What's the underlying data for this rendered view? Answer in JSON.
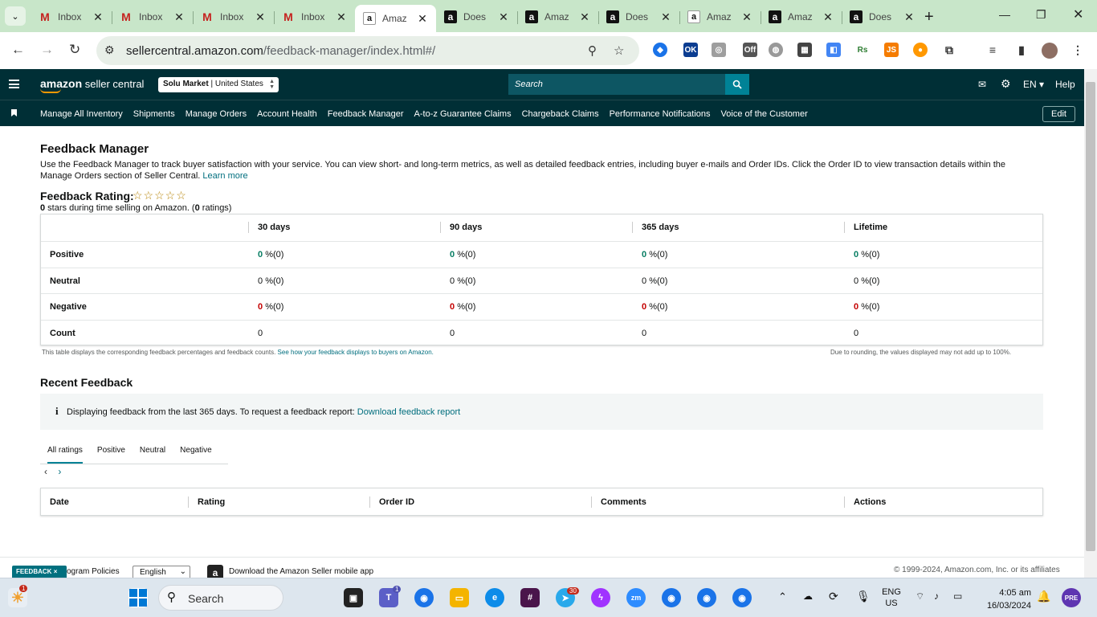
{
  "browser": {
    "tabs": [
      {
        "title": "Inbox",
        "favicon": "gmail-icon"
      },
      {
        "title": "Inbox",
        "favicon": "gmail-icon"
      },
      {
        "title": "Inbox",
        "favicon": "gmail-icon"
      },
      {
        "title": "Inbox",
        "favicon": "gmail-icon"
      },
      {
        "title": "Amaz",
        "favicon": "amazon-icon",
        "active": true
      },
      {
        "title": "Does",
        "favicon": "amazon-icon"
      },
      {
        "title": "Amaz",
        "favicon": "amazon-icon"
      },
      {
        "title": "Does",
        "favicon": "amazon-icon"
      },
      {
        "title": "Amaz",
        "favicon": "amazon-icon"
      },
      {
        "title": "Amaz",
        "favicon": "amazon-icon"
      },
      {
        "title": "Does",
        "favicon": "amazon-icon"
      }
    ],
    "url_host": "sellercentral.amazon.com",
    "url_path": "/feedback-manager/index.html#/"
  },
  "header": {
    "logo_bold": "amazon",
    "logo_rest": " seller central",
    "store": "Solu Market",
    "marketplace": "United States",
    "search_placeholder": "Search",
    "language": "EN",
    "help": "Help"
  },
  "nav": {
    "links": [
      "Manage All Inventory",
      "Shipments",
      "Manage Orders",
      "Account Health",
      "Feedback Manager",
      "A-to-z Guarantee Claims",
      "Chargeback Claims",
      "Performance Notifications",
      "Voice of the Customer"
    ],
    "edit": "Edit"
  },
  "page": {
    "title": "Feedback Manager",
    "intro": "Use the Feedback Manager to track buyer satisfaction with your service. You can view short- and long-term metrics, as well as detailed feedback entries, including buyer e-mails and Order IDs. Click the Order ID to view transaction details within the Manage Orders section of Seller Central.",
    "learn_more": "Learn more",
    "rating_title": "Feedback Rating:",
    "rating_stars": "☆☆☆☆☆",
    "rating_value": "0",
    "rating_sub_mid": " stars during time selling on Amazon. (",
    "rating_count": "0",
    "rating_sub_end": " ratings)"
  },
  "metrics": {
    "columns": [
      "30 days",
      "90 days",
      "365 days",
      "Lifetime"
    ],
    "rows": [
      {
        "label": "Positive",
        "values": [
          "0",
          "0",
          "0",
          "0"
        ],
        "suffix": "%(0)"
      },
      {
        "label": "Neutral",
        "values": [
          "0",
          "0",
          "0",
          "0"
        ],
        "suffix": "%(0)"
      },
      {
        "label": "Negative",
        "values": [
          "0",
          "0",
          "0",
          "0"
        ],
        "suffix": "%(0)"
      },
      {
        "label": "Count",
        "values": [
          "0",
          "0",
          "0",
          "0"
        ],
        "suffix": ""
      }
    ],
    "note_left": "This table displays the corresponding feedback percentages and feedback counts.",
    "note_link": "See how your feedback displays to buyers on Amazon.",
    "note_right": "Due to rounding, the values displayed may not add up to 100%."
  },
  "recent": {
    "title": "Recent Feedback",
    "info": "Displaying feedback from the last 365 days. To request a feedback report:",
    "info_link": "Download feedback report",
    "tabs": [
      "All ratings",
      "Positive",
      "Neutral",
      "Negative"
    ],
    "columns": [
      "Date",
      "Rating",
      "Order ID",
      "Comments",
      "Actions"
    ]
  },
  "footer": {
    "feedback_badge": "FEEDBACK",
    "policies": "ogram Policies",
    "language": "English",
    "app_text": "Download the Amazon Seller mobile app",
    "copyright": "© 1999-2024, Amazon.com, Inc. or its affiliates"
  },
  "taskbar": {
    "search": "Search",
    "lang1": "ENG",
    "lang2": "US",
    "time": "4:05 am",
    "date": "16/03/2024",
    "teams_badge": "1",
    "telegram_badge": "30",
    "weather_badge": "1"
  }
}
